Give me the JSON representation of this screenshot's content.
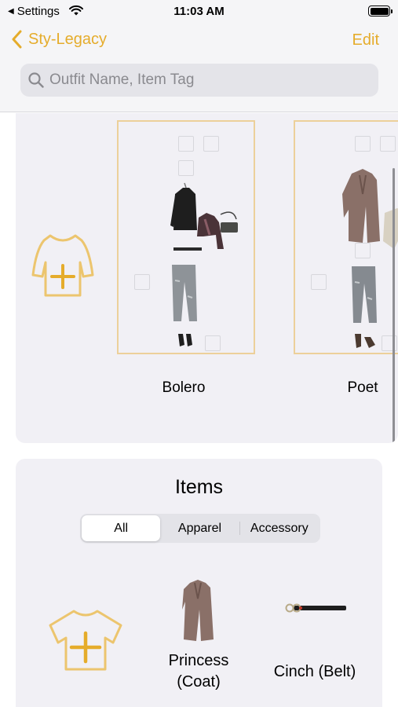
{
  "status_bar": {
    "back_label": "Settings",
    "time": "11:03 AM"
  },
  "nav": {
    "back_label": "Sty-Legacy",
    "edit_label": "Edit"
  },
  "search": {
    "placeholder": "Outfit Name, Item Tag",
    "value": ""
  },
  "outfits": [
    {
      "name": "Bolero"
    },
    {
      "name": "Poet"
    }
  ],
  "items_section": {
    "title": "Items",
    "segments": [
      "All",
      "Apparel",
      "Accessory"
    ],
    "selected_segment": "All",
    "items": [
      {
        "label_line1": "Princess",
        "label_line2": "(Coat)"
      },
      {
        "label_line1": "Cinch (Belt)"
      }
    ]
  },
  "colors": {
    "accent": "#e5ac2b",
    "card_border": "#ecd09a",
    "panel_bg": "#f1f0f5"
  },
  "icons": [
    "wifi-icon",
    "battery-icon",
    "chevron-left-icon",
    "search-icon",
    "add-outfit-icon",
    "add-item-icon"
  ]
}
